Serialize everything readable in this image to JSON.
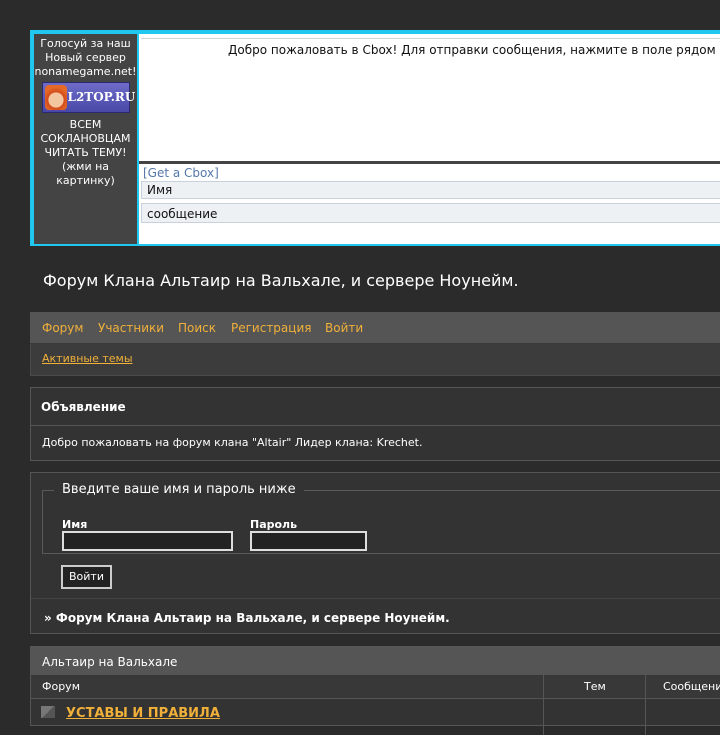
{
  "ad": {
    "vote_text": "Голосуй за наш Новый сервер nonamegame.net!",
    "banner_label": "L2TOP.RU",
    "note": "ВСЕМ СОКЛАНОВЦАМ ЧИТАТЬ ТЕМУ! (жми на картинку)"
  },
  "cbox": {
    "welcome": "Добро пожаловать в Cbox! Для отправки сообщения, нажмите в поле рядом и",
    "get_link": "[Get a Cbox]",
    "name_value": "Имя",
    "message_value": "сообщение"
  },
  "forum": {
    "title": "Форум Клана Альтаир на Вальхале, и сервере Ноунейм."
  },
  "nav": {
    "items": [
      "Форум",
      "Участники",
      "Поиск",
      "Регистрация",
      "Войти"
    ],
    "active_topics": "Активные темы"
  },
  "announcement": {
    "title": "Объявление",
    "body": "Добро пожаловать на форум клана \"Altair\" Лидер клана: Krechet."
  },
  "login": {
    "legend": "Введите ваше имя и пароль ниже",
    "name_label": "Имя",
    "password_label": "Пароль",
    "name_value": "",
    "password_value": "",
    "button": "Войти",
    "breadcrumb": "» Форум Клана Альтаир на Вальхале, и сервере Ноунейм."
  },
  "category": {
    "title": "Альтаир на Вальхале",
    "col_forum": "Форум",
    "col_topics": "Тем",
    "col_posts": "Сообщени",
    "first_forum": "УСТАВЫ И ПРАВИЛА"
  },
  "colors": {
    "accent": "#f0b03a",
    "frame": "#1ec8f0",
    "background": "#2b2b2b"
  }
}
